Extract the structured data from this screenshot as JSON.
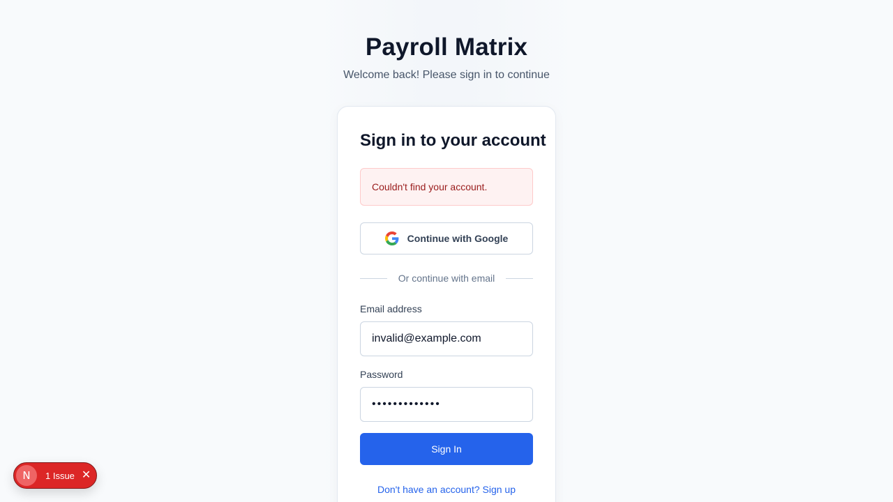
{
  "header": {
    "title": "Payroll Matrix",
    "subtitle": "Welcome back! Please sign in to continue"
  },
  "card": {
    "title": "Sign in to your account",
    "error_message": "Couldn't find your account.",
    "google_button_label": "Continue with Google",
    "divider_text": "Or continue with email",
    "email": {
      "label": "Email address",
      "value": "invalid@example.com"
    },
    "password": {
      "label": "Password",
      "value": "•••••••••••••"
    },
    "signin_button_label": "Sign In",
    "signup_link": "Don't have an account? Sign up"
  },
  "issue_badge": {
    "logo_letter": "N",
    "text": "1 Issue",
    "close_glyph": "✕"
  },
  "colors": {
    "primary": "#2563eb",
    "error_bg": "#fef2f2",
    "error_text": "#991b1b",
    "badge": "#dc2626"
  },
  "icons": [
    "google-icon",
    "close-icon",
    "nextjs-logo-icon"
  ]
}
